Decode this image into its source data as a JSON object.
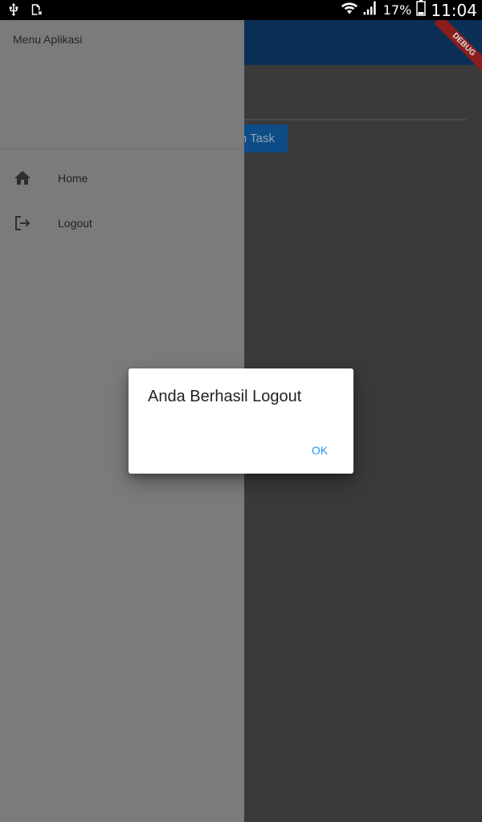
{
  "status_bar": {
    "battery": "17%",
    "time": "11:04",
    "icons": [
      "usb-icon",
      "sim-error-icon",
      "wifi-icon",
      "signal-icon",
      "battery-icon"
    ]
  },
  "background": {
    "button_label": "n Task",
    "app_bar_color": "#0b2f55",
    "debug_banner": "DEBUG"
  },
  "drawer": {
    "title": "Menu Aplikasi",
    "items": [
      {
        "label": "Home",
        "icon": "home-icon"
      },
      {
        "label": "Logout",
        "icon": "logout-icon"
      }
    ]
  },
  "dialog": {
    "title": "Anda Berhasil Logout",
    "ok_label": "OK",
    "accent": "#2196f3"
  }
}
